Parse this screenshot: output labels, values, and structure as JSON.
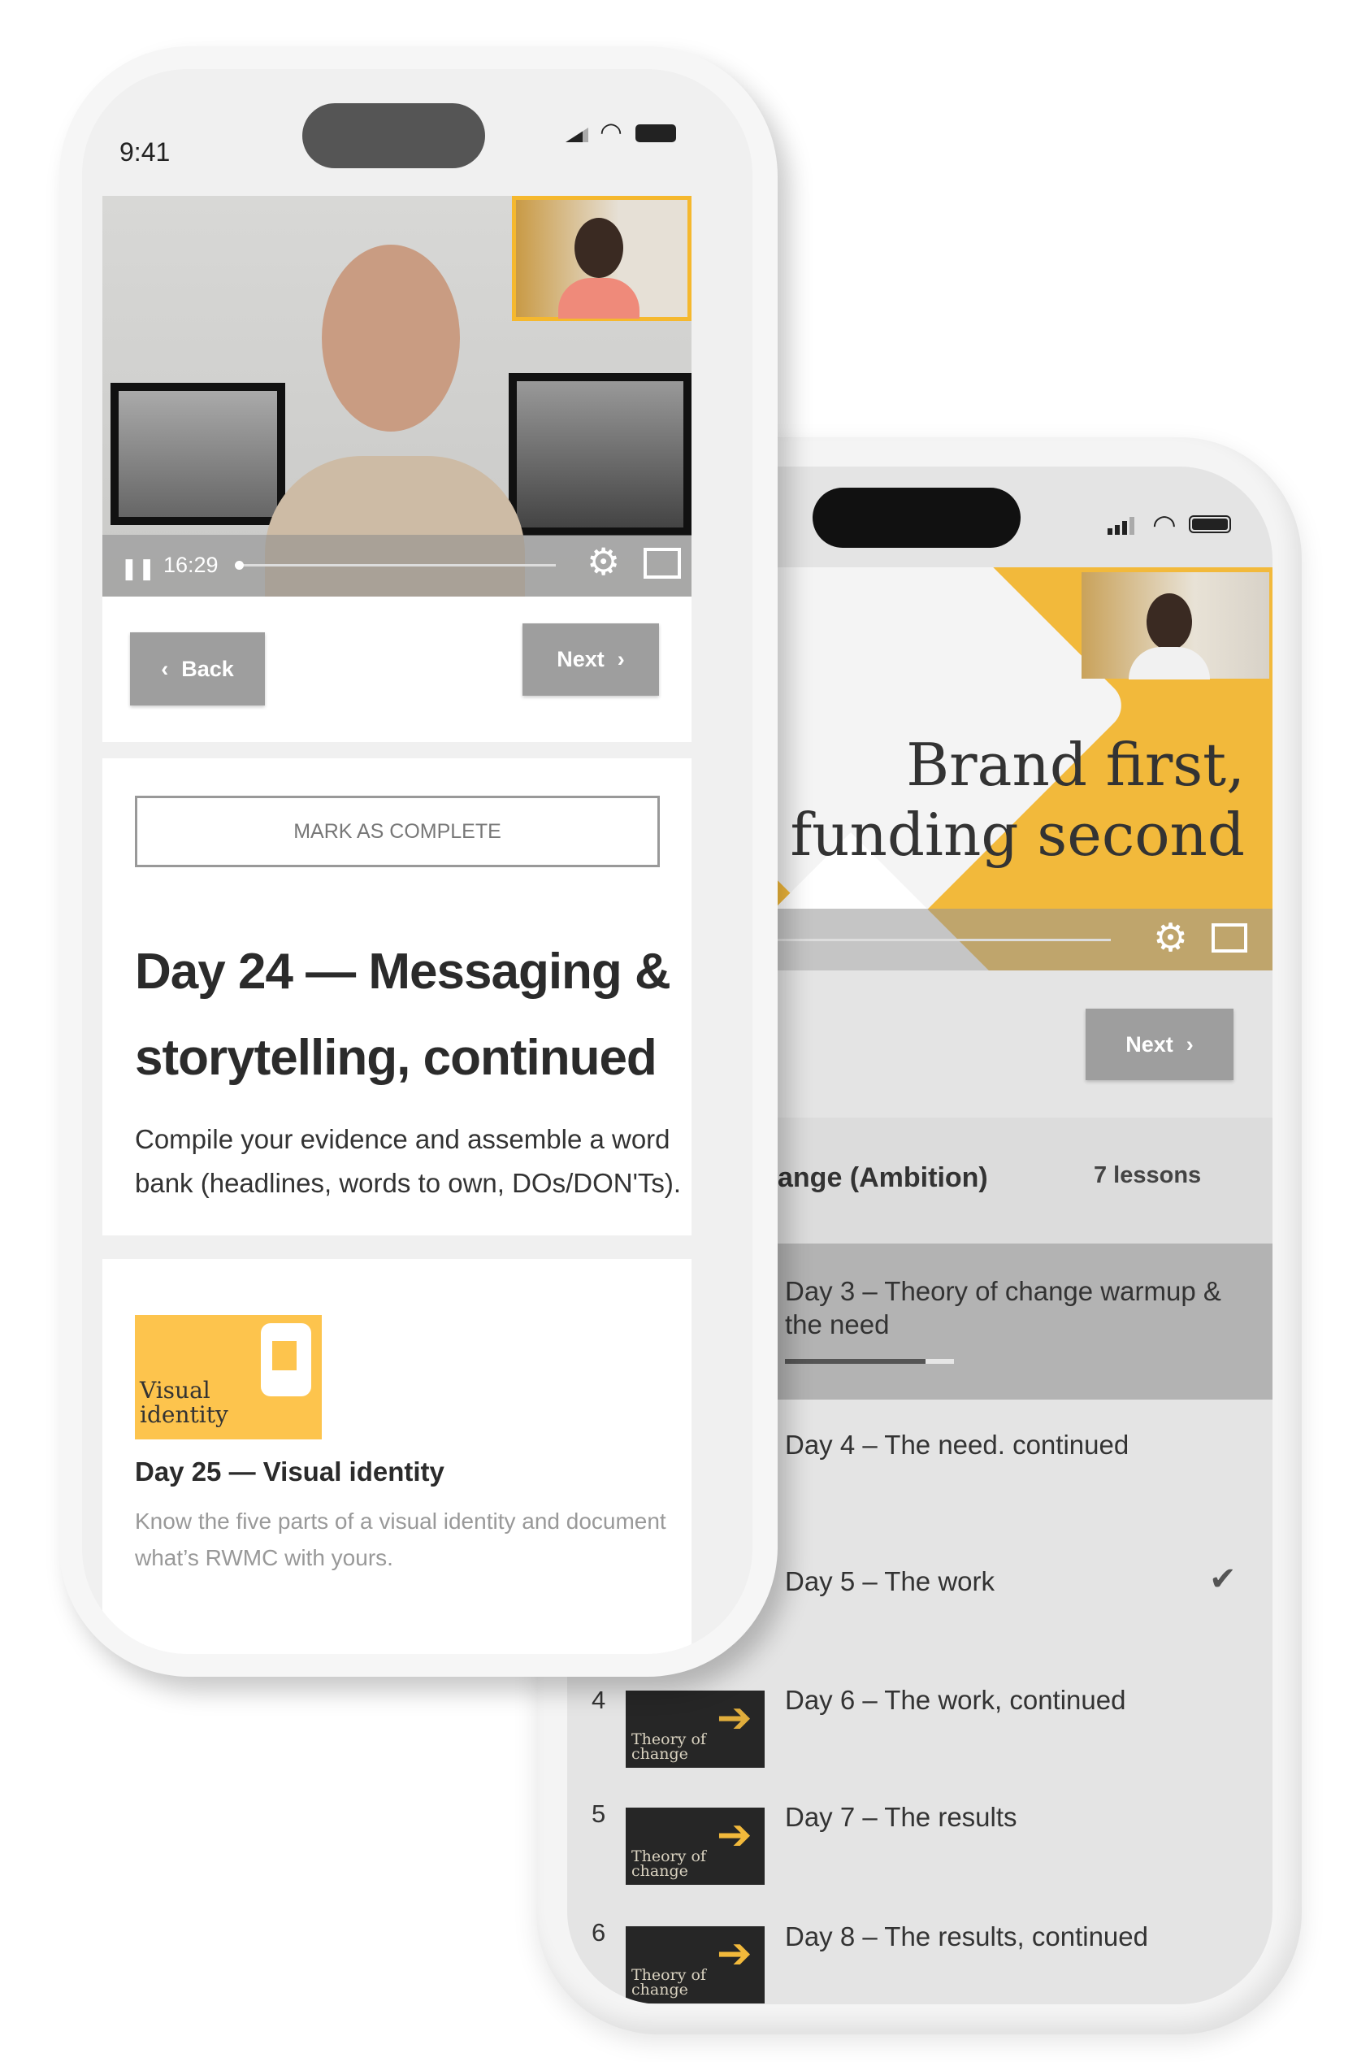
{
  "front": {
    "status_time": "9:41",
    "video": {
      "time": "16:29",
      "progress": 0.0
    },
    "nav": {
      "back_label": "Back",
      "next_label": "Next"
    },
    "lesson": {
      "mark_complete_label": "MARK AS COMPLETE",
      "title_line1": "Day 24 — Messaging &",
      "title_line2": "storytelling, continued",
      "desc_line1": "Compile your evidence and assemble a word",
      "desc_line2": "bank (headlines, words to own, DOs/DON'Ts)."
    },
    "next_lesson": {
      "thumb_title_line1": "Visual",
      "thumb_title_line2": "identity",
      "title": "Day 25 — Visual identity",
      "desc_line1": "Know the five parts of a visual identity and document",
      "desc_line2": "what’s RWMC with yours."
    }
  },
  "back": {
    "video": {
      "title_line1": "Brand first,",
      "title_line2": "funding second"
    },
    "next_label": "Next",
    "section": {
      "title": "ange (Ambition)",
      "count": "7 lessons"
    },
    "lessons": [
      {
        "title_line1": "Day 3 – Theory of change warmup &",
        "title_line2": "the need",
        "progress": 0.83,
        "active": true
      },
      {
        "title": "Day 4 – The need. continued"
      },
      {
        "title": "Day 5 – The work",
        "completed": true
      },
      {
        "number": "4",
        "title": "Day 6 – The work, continued",
        "thumb_line1": "Theory of",
        "thumb_line2": "change"
      },
      {
        "number": "5",
        "title": "Day 7 – The results",
        "thumb_line1": "Theory of",
        "thumb_line2": "change"
      },
      {
        "number": "6",
        "title": "Day 8 – The results, continued",
        "thumb_line1": "Theory of",
        "thumb_line2": "change"
      }
    ]
  },
  "colors": {
    "accent_yellow": "#f2b93b",
    "thumb_yellow": "#fdc44d",
    "button_grey": "#9e9e9e"
  }
}
